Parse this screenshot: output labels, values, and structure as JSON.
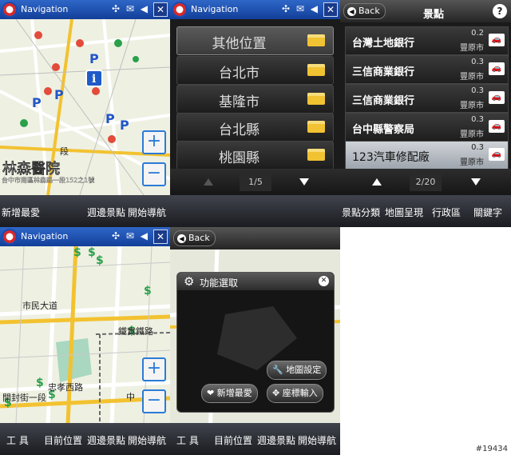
{
  "screens": {
    "map1": {
      "title": "Navigation",
      "place_label": "林森醫院",
      "address": "台中市南區林森路一段152之1號",
      "road_label": "段",
      "bottom_left": "新增最愛",
      "bottom_mid": "週邊景點",
      "bottom_right": "開始導航"
    },
    "cities": {
      "title": "Navigation",
      "items": [
        "其他位置",
        "台北市",
        "基隆市",
        "台北縣",
        "桃園縣"
      ],
      "page": "1/5"
    },
    "poi": {
      "back": "Back",
      "header": "景點",
      "help": "?",
      "items": [
        {
          "name": "台灣土地銀行",
          "dist": "0.2",
          "area": "豐原市"
        },
        {
          "name": "三信商業銀行",
          "dist": "0.3",
          "area": "豐原市"
        },
        {
          "name": "三信商業銀行",
          "dist": "0.3",
          "area": "豐原市"
        },
        {
          "name": "台中縣警察局",
          "dist": "0.3",
          "area": "豐原市"
        },
        {
          "name": "123汽車修配廠",
          "dist": "0.3",
          "area": "豐原市"
        }
      ],
      "page": "2/20",
      "tabs": [
        "景點分類",
        "地圖呈現",
        "行政區",
        "關鍵字"
      ]
    },
    "map2": {
      "title": "Navigation",
      "road1": "市民大道",
      "road2": "鐵實鐵路",
      "road3": "忠孝西路",
      "road4": "開封街一段",
      "road5": "中",
      "bottom": [
        "工 具",
        "目前位置",
        "週邊景點",
        "開始導航"
      ]
    },
    "func": {
      "back": "Back",
      "dialog_title": "功能選取",
      "btn_map_settings": "地圖設定",
      "btn_add_fav": "新增最愛",
      "btn_coord_input": "座標輸入",
      "bottom": [
        "工 具",
        "目前位置",
        "週邊景點",
        "開始導航"
      ]
    }
  },
  "watermark": "#19434",
  "colors": {
    "titlebar": "#1f4fb0",
    "folder": "#f1c232",
    "zoom": "#2b7bd6"
  }
}
